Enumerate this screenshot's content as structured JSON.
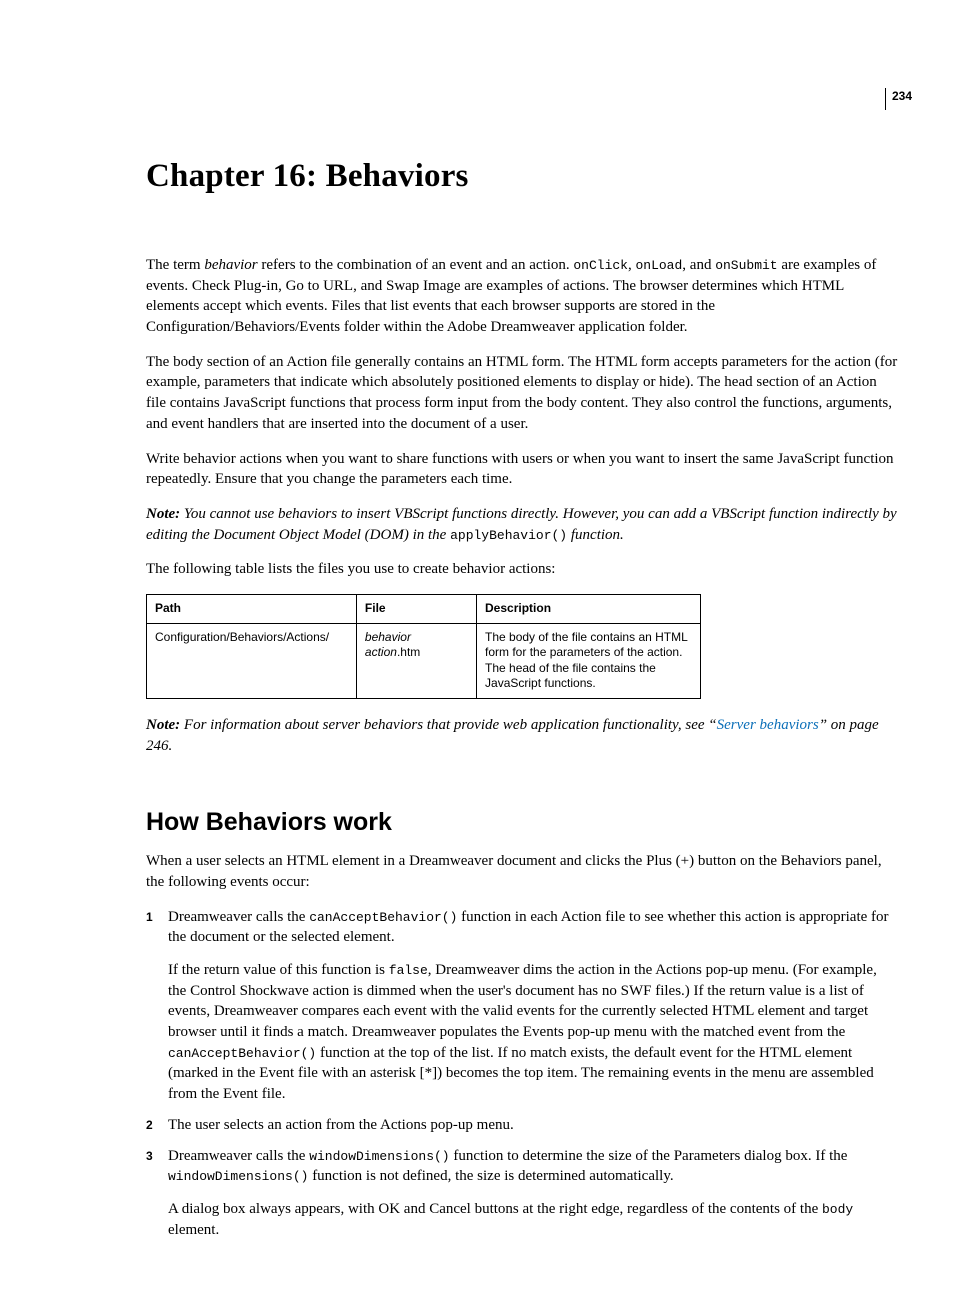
{
  "page_number": "234",
  "chapter_title": "Chapter 16: Behaviors",
  "p1_a": "The term ",
  "p1_behavior": "behavior",
  "p1_b": " refers to the combination of an event and an action. ",
  "code_onClick": "onClick",
  "p1_c": ", ",
  "code_onLoad": "onLoad",
  "p1_d": ", and ",
  "code_onSubmit": "onSubmit",
  "p1_e": " are examples of events. Check Plug-in, Go to URL, and Swap Image are examples of actions. The browser determines which HTML elements accept which events. Files that list events that each browser supports are stored in the Configuration/Behaviors/Events folder within the Adobe Dreamweaver application folder.",
  "p2": "The body section of an Action file generally contains an HTML form. The HTML form accepts parameters for the action (for example, parameters that indicate which absolutely positioned elements to display or hide). The head section of an Action file contains JavaScript functions that process form input from the body content. They also control the functions, arguments, and event handlers that are inserted into the document of a user.",
  "p3": "Write behavior actions when you want to share functions with users or when you want to insert the same JavaScript function repeatedly. Ensure that you change the parameters each time.",
  "note1_lead": "Note: ",
  "note1_a": "You cannot use behaviors to insert VBScript functions directly. However, you can add a VBScript function indirectly by editing the Document Object Model (DOM) in the ",
  "note1_code": "applyBehavior()",
  "note1_b": " function.",
  "p4": "The following table lists the files you use to create behavior actions:",
  "table": {
    "headers": {
      "path": "Path",
      "file": "File",
      "desc": "Description"
    },
    "row": {
      "path": "Configuration/Behaviors/Actions/",
      "file_italic": "behavior action",
      "file_ext": ".htm",
      "desc": "The body of the file contains an HTML form for the parameters of the action. The head of the file contains the JavaScript functions."
    }
  },
  "note2_lead": "Note: ",
  "note2_a": "For information about server behaviors that provide web application functionality, see “",
  "note2_link": "Server behaviors",
  "note2_b": "” on page 246.",
  "section_title": "How Behaviors work",
  "s_p1": "When a user selects an HTML element in a Dreamweaver document and clicks the Plus (+) button on the Behaviors panel, the following events occur:",
  "step1_a": "Dreamweaver calls the ",
  "step1_code1": "canAcceptBehavior()",
  "step1_b": " function in each Action file to see whether this action is appropriate for the document or the selected element.",
  "step1_p2_a": "If the return value of this function is ",
  "step1_code_false": "false",
  "step1_p2_b": ", Dreamweaver dims the action in the Actions pop-up menu. (For example, the Control Shockwave action is dimmed when the user's document has no SWF files.) If the return value is a list of events, Dreamweaver compares each event with the valid events for the currently selected HTML element and target browser until it finds a match. Dreamweaver populates the Events pop-up menu with the matched event from the ",
  "step1_code2": "canAcceptBehavior()",
  "step1_p2_c": " function at the top of the list. If no match exists, the default event for the HTML element (marked in the Event file with an asterisk [*]) becomes the top item. The remaining events in the menu are assembled from the Event file.",
  "step2": "The user selects an action from the Actions pop-up menu.",
  "step3_a": "Dreamweaver calls the ",
  "step3_code1": "windowDimensions()",
  "step3_b": " function to determine the size of the Parameters dialog box. If the ",
  "step3_code2": "windowDimensions()",
  "step3_c": " function is not defined, the size is determined automatically.",
  "step3_p2_a": "A dialog box always appears, with OK and Cancel buttons at the right edge, regardless of the contents of the ",
  "step3_code_body": "body",
  "step3_p2_b": " element."
}
